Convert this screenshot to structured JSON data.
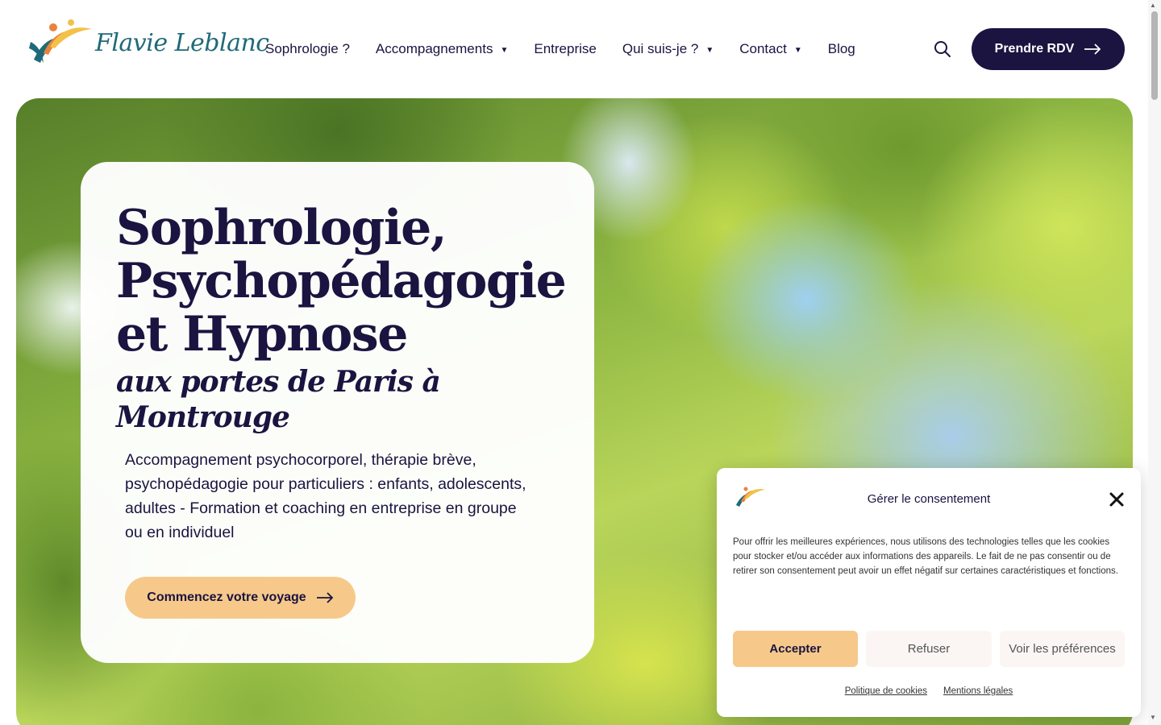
{
  "header": {
    "logo_text": "Flavie Leblanc",
    "nav": [
      {
        "label": "Sophrologie ?",
        "has_dropdown": false
      },
      {
        "label": "Accompagnements",
        "has_dropdown": true
      },
      {
        "label": "Entreprise",
        "has_dropdown": false
      },
      {
        "label": "Qui suis-je ?",
        "has_dropdown": true
      },
      {
        "label": "Contact",
        "has_dropdown": true
      },
      {
        "label": "Blog",
        "has_dropdown": false
      }
    ],
    "search_icon": "search-icon",
    "cta_label": "Prendre RDV",
    "cta_icon": "arrow-right-icon"
  },
  "hero": {
    "title": "Sophrologie, Psychopédagogie et Hypnose",
    "subtitle": "aux portes de Paris à Montrouge",
    "description": "Accompagnement psychocorporel, thérapie brève, psychopédagogie pour particuliers : enfants, adolescents, adultes - Formation et coaching en entreprise en groupe ou en individuel",
    "cta_label": "Commencez votre voyage",
    "cta_icon": "arrow-right-icon"
  },
  "consent": {
    "title": "Gérer le consentement",
    "text": "Pour offrir les meilleures expériences, nous utilisons des technologies telles que les cookies pour stocker et/ou accéder aux informations des appareils. Le fait de ne pas consentir ou de retirer son consentement peut avoir un effet négatif sur certaines caractéristiques et fonctions.",
    "accept_label": "Accepter",
    "refuse_label": "Refuser",
    "prefs_label": "Voir les préférences",
    "links": [
      "Politique de cookies",
      "Mentions légales"
    ],
    "close_icon": "close-icon"
  },
  "colors": {
    "brand_dark": "#1b1340",
    "accent_peach": "#f6c98a",
    "logo_teal": "#1f6a78"
  }
}
